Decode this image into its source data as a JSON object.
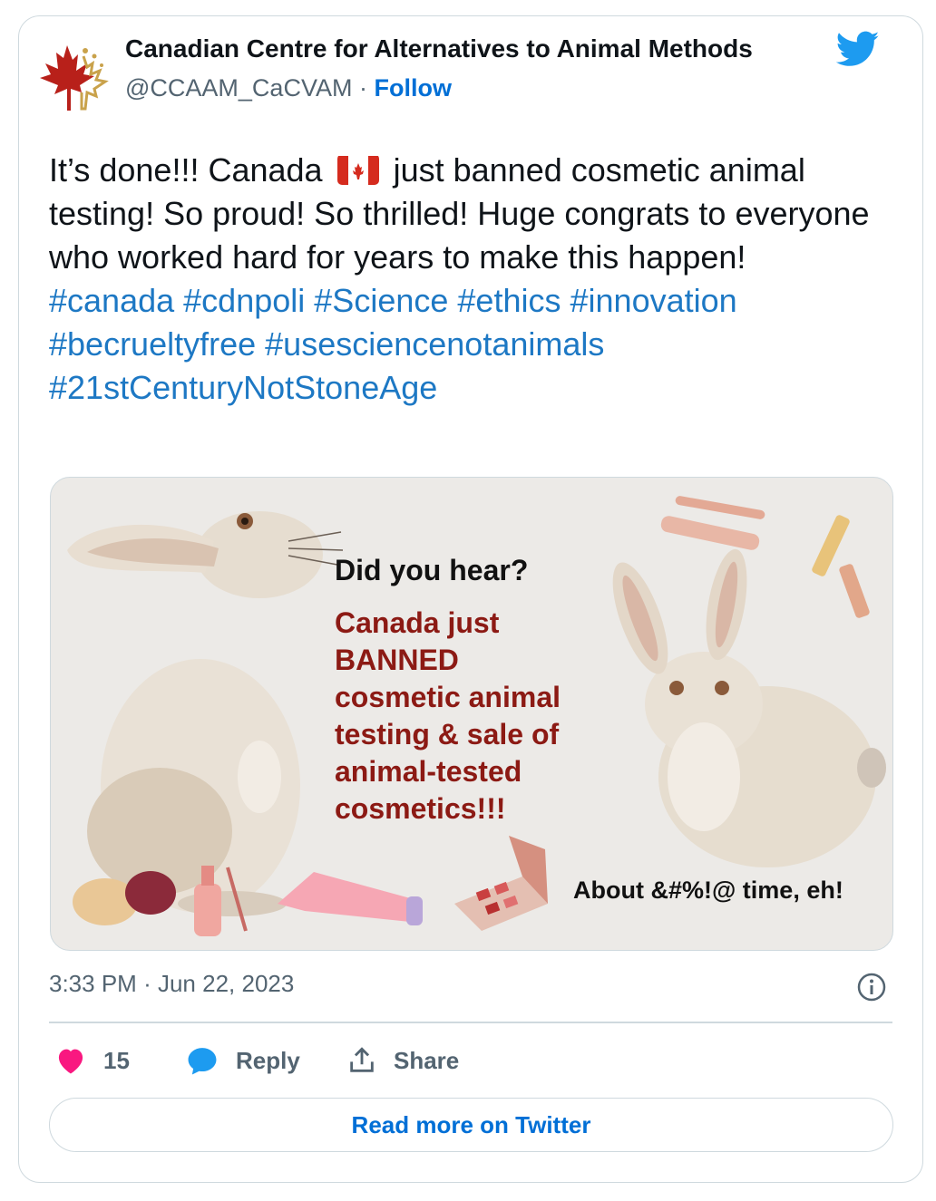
{
  "author": {
    "name": "Canadian Centre for Alternatives to Animal Methods",
    "handle": "@CCAAM_CaCVAM",
    "separator": "·",
    "follow_label": "Follow"
  },
  "tweet": {
    "text_before_flag": "It’s done!!! Canada",
    "text_after_flag": "just banned cosmetic animal testing! So proud! So thrilled! Huge congrats to everyone who worked hard for years to make this happen!",
    "hashtags": [
      "#canada",
      "#cdnpoli",
      "#Science",
      "#ethics",
      "#innovation",
      "#becrueltyfree",
      "#usesciencenotanimals",
      "#21stCenturyNotStoneAge"
    ]
  },
  "media": {
    "headline": "Did you hear?",
    "body_lines": [
      "Canada just",
      "BANNED",
      "cosmetic animal",
      "testing & sale of",
      "animal-tested",
      "cosmetics!!!"
    ],
    "footer": "About &#%!@ time, eh!"
  },
  "meta": {
    "time": "3:33 PM",
    "separator": "·",
    "date": "Jun 22, 2023"
  },
  "actions": {
    "like_count": "15",
    "reply_label": "Reply",
    "share_label": "Share"
  },
  "read_more_label": "Read more on Twitter",
  "colors": {
    "link": "#006fd6",
    "hashtag": "#1d78c4",
    "banner_red": "#8c1a14",
    "heart": "#f91880",
    "reply_blue": "#1d9bf0",
    "border": "#cfd9de"
  },
  "icons": [
    "maple-leaf-logo",
    "twitter-bird-icon",
    "canada-flag",
    "info-icon",
    "heart-icon",
    "reply-bubble-icon",
    "share-icon"
  ]
}
